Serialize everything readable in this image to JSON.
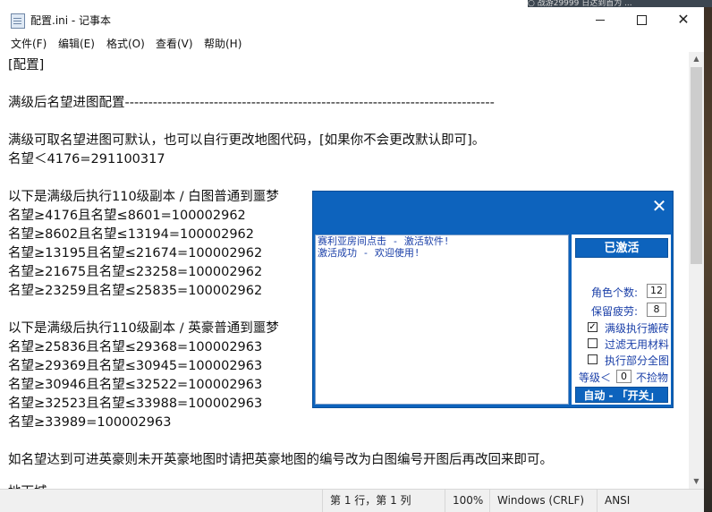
{
  "background_snippet": "○ 战游29999 日达到首为 ...",
  "window": {
    "title": "配置.ini - 记事本",
    "minimize_glyph": "",
    "close_glyph": "✕"
  },
  "menu": [
    "文件(F)",
    "编辑(E)",
    "格式(O)",
    "查看(V)",
    "帮助(H)"
  ],
  "editor_lines": [
    "[配置]",
    "",
    "满级后名望进图配置-------------------------------------------------------------------------------",
    "",
    "满级可取名望进图可默认，也可以自行更改地图代码，[如果你不会更改默认即可]。",
    "名望＜4176=291100317",
    "",
    "以下是满级后执行110级副本 / 白图普通到噩梦",
    "名望≥4176且名望≤8601=100002962",
    "名望≥8602且名望≤13194=100002962",
    "名望≥13195且名望≤21674=100002962",
    "名望≥21675且名望≤23258=100002962",
    "名望≥23259且名望≤25835=100002962",
    "",
    "以下是满级后执行110级副本 / 英豪普通到噩梦",
    "名望≥25836且名望≤29368=100002963",
    "名望≥29369且名望≤30945=100002963",
    "名望≥30946且名望≤32522=100002963",
    "名望≥32523且名望≤33988=100002963",
    "名望≥33989=100002963",
    "",
    "如名望达到可进英豪则未开英豪地图时请把英豪地图的编号改为白图编号开图后再改回来即可。",
    "",
    "地下城..."
  ],
  "statusbar": {
    "position": "第 1 行，第 1 列",
    "zoom": "100%",
    "line_ending": "Windows (CRLF)",
    "encoding": "ANSI"
  },
  "overlay": {
    "close_glyph": "✕",
    "log": [
      "赛利亚房间点击 - 激活软件!",
      "激活成功 - 欢迎使用!"
    ],
    "activated_label": "已激活",
    "role_count_label": "角色个数:",
    "role_count_value": "12",
    "reserve_fatigue_label": "保留疲劳:",
    "reserve_fatigue_value": "8",
    "checkboxes": [
      {
        "label": "满级执行搬砖",
        "checked": true
      },
      {
        "label": "过滤无用材料",
        "checked": false
      },
      {
        "label": "执行部分全图",
        "checked": false
      }
    ],
    "level_prefix": "等级＜",
    "level_value": "0",
    "level_suffix": "不捡物",
    "auto_button": "自动 - 「开关」",
    "colors": {
      "accent": "#0d63bd",
      "log_text": "#1a3fa8"
    }
  }
}
